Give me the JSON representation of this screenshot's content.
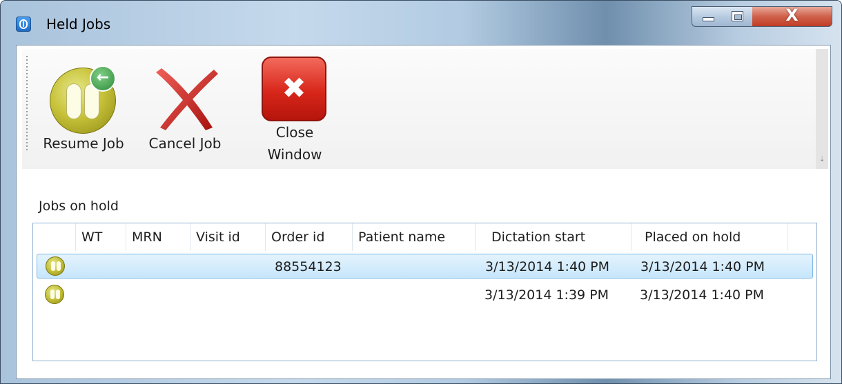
{
  "window": {
    "title": "Held Jobs",
    "controls": {
      "minimize": "minimize",
      "maximize": "maximize",
      "close": "X"
    }
  },
  "toolbar": {
    "resume_label": "Resume Job",
    "cancel_label": "Cancel Job",
    "close_label_line1": "Close",
    "close_label_line2": "Window"
  },
  "jobs": {
    "section_label": "Jobs on hold",
    "columns": [
      "WT",
      "MRN",
      "Visit id",
      "Order id",
      "Patient name",
      "Dictation start",
      "Placed on hold"
    ],
    "rows": [
      {
        "status_icon": "pause-icon",
        "wt": "",
        "mrn": "",
        "visit_id": "",
        "order_id": "88554123",
        "patient_name": "",
        "dictation_start": "3/13/2014 1:40 PM",
        "placed_on_hold": "3/13/2014 1:40 PM",
        "selected": true
      },
      {
        "status_icon": "pause-icon",
        "wt": "",
        "mrn": "",
        "visit_id": "",
        "order_id": "",
        "patient_name": "",
        "dictation_start": "3/13/2014 1:39 PM",
        "placed_on_hold": "3/13/2014 1:40 PM",
        "selected": false
      }
    ]
  },
  "colors": {
    "selection": "#c6e6fb",
    "close_button": "#d8261a",
    "pause_icon": "#c8c33a"
  }
}
